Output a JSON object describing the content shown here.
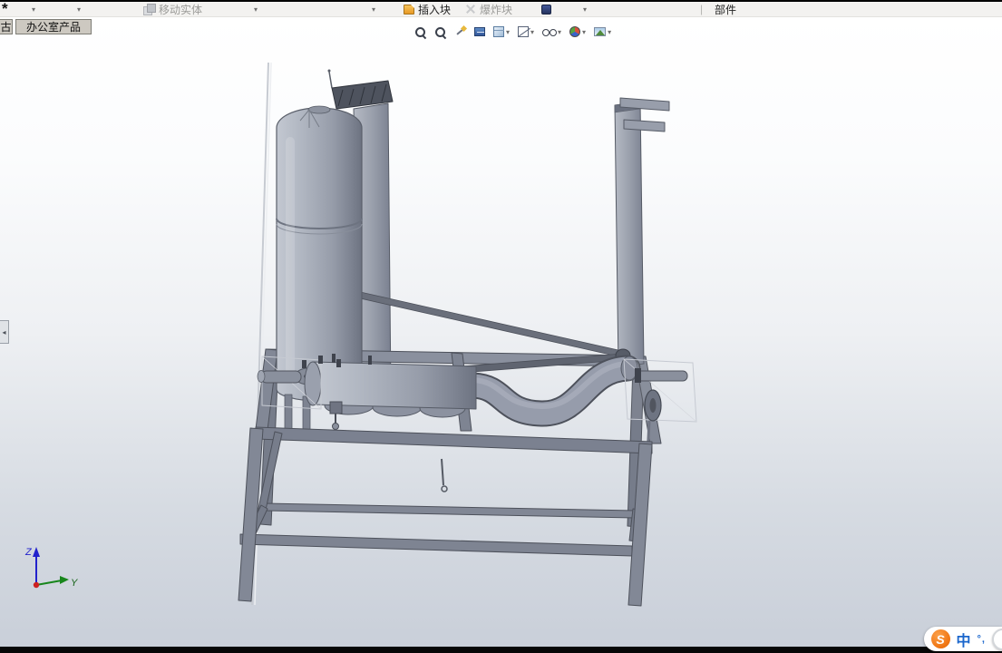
{
  "toolbar": {
    "move_entity": "移动实体",
    "insert_block": "插入块",
    "explode_block": "爆炸块",
    "component": "部件"
  },
  "tabs": {
    "partial": "古",
    "active": "办公室产品"
  },
  "icons": {
    "caret": "▾",
    "separator": "|",
    "asterisk": "*",
    "left_arrow": "◂"
  },
  "viewbar": {
    "tools": [
      "zoom-to-fit",
      "zoom-to-area",
      "magnified-selection",
      "section-view",
      "view-orientation",
      "display-style",
      "hide-show-items",
      "edit-appearance",
      "apply-scene",
      "view-settings"
    ]
  },
  "triad": {
    "z": "Z",
    "y": "Y"
  },
  "ime": {
    "logo": "S",
    "lang": "中",
    "marks": "°,"
  }
}
